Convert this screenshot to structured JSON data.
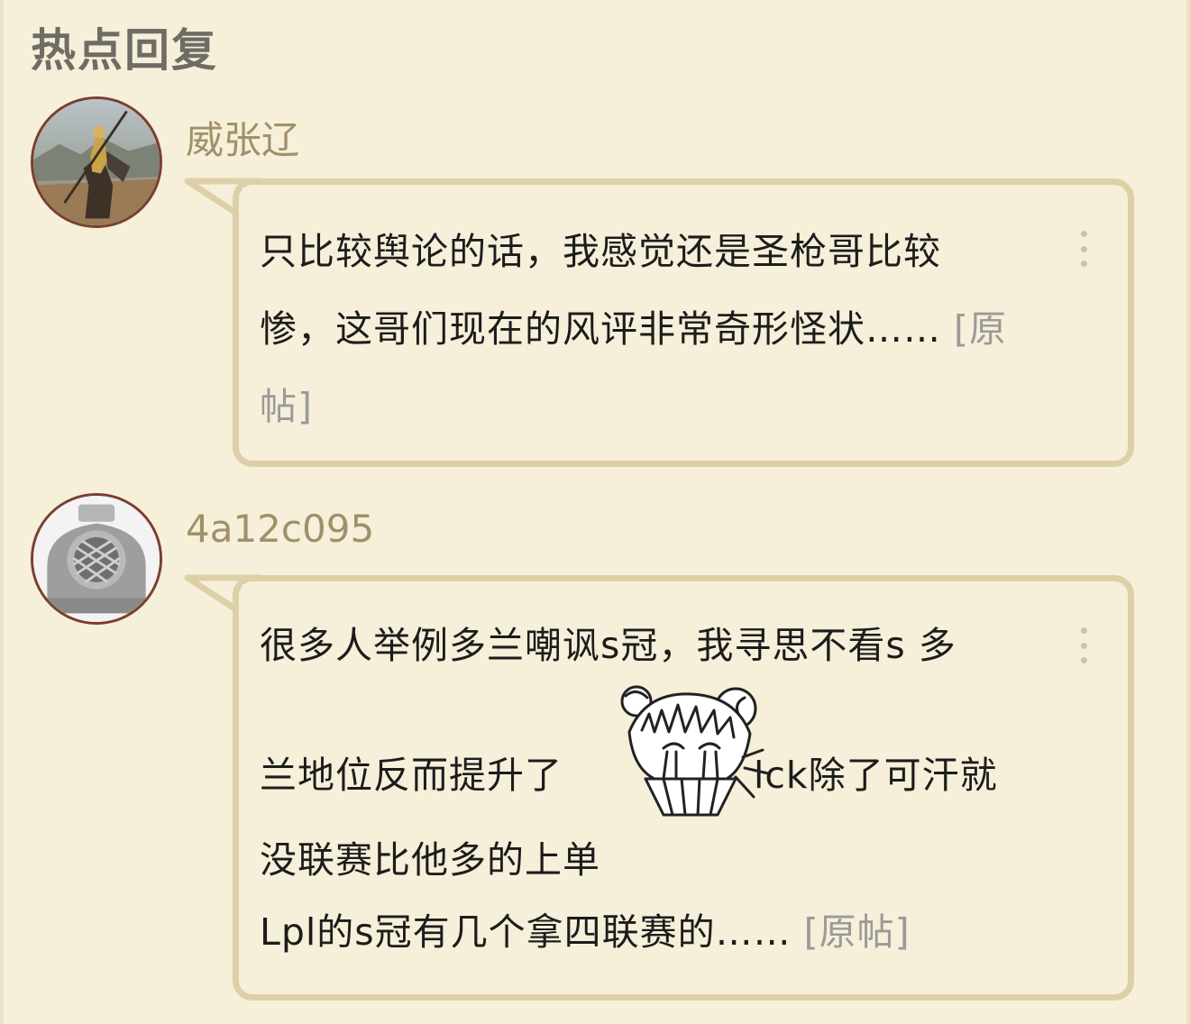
{
  "section_title": "热点回复",
  "comments": [
    {
      "username": "威张辽",
      "lines": [
        "只比较舆论的话，我感觉还是圣枪哥比较",
        "惨，这哥们现在的风评非常奇形怪状……"
      ],
      "orig_part1": "[原",
      "orig_part2": "帖]"
    },
    {
      "username": "4a12c095",
      "line1": "很多人举例多兰嘲讽s冠，我寻思不看s 多",
      "line2_before": "兰地位反而提升了",
      "line2_after": "lck除了可汗就",
      "line3": "没联赛比他多的上单",
      "line4": "Lpl的s冠有几个拿四联赛的……",
      "orig": "[原帖]"
    }
  ],
  "icons": {
    "avatar_1": "warrior-on-horse-avatar",
    "avatar_2": "diving-helmet-avatar",
    "more": "vertical-ellipsis-icon",
    "sticker": "anime-girl-crying-fan-sticker"
  },
  "colors": {
    "background": "#f6efd9",
    "bubble_border": "#ddd0a8",
    "username": "#a0906a",
    "title": "#6f6c66",
    "text": "#1c1c1c",
    "link": "#9a9a9a"
  }
}
